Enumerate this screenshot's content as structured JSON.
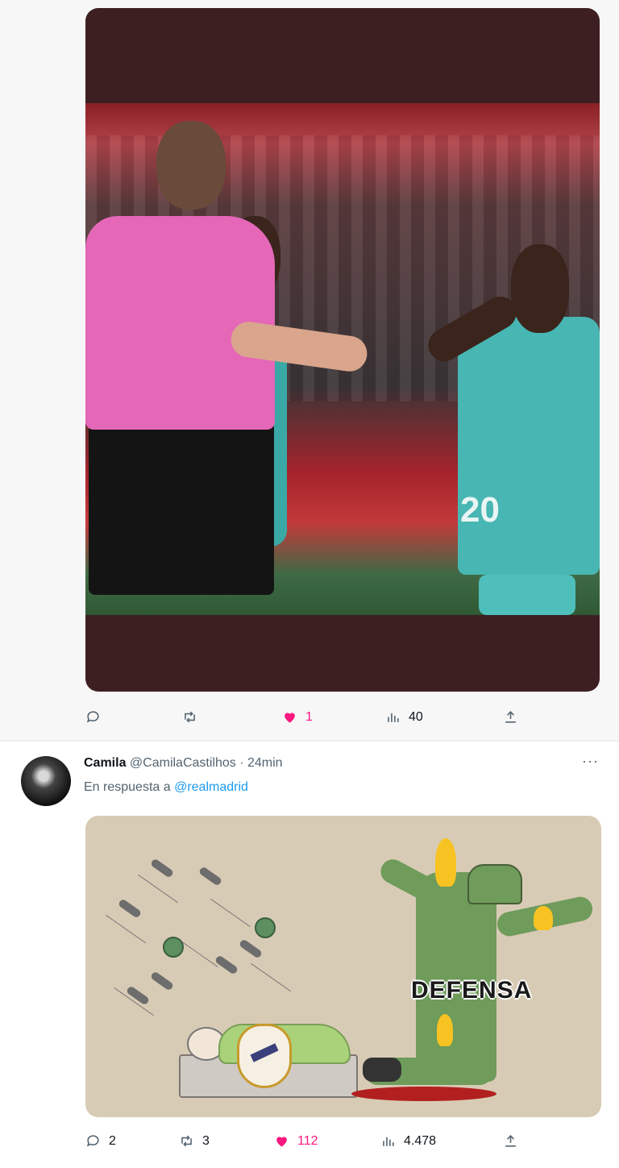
{
  "tweet1": {
    "actions": {
      "replies": "",
      "retweets": "",
      "likes": "1",
      "views": "40"
    },
    "colors": {
      "like": "#f91880",
      "icon": "#536471"
    }
  },
  "tweet2": {
    "author_name": "Camila",
    "handle": "@CamilaCastilhos",
    "separator": "·",
    "time": "24min",
    "reply_prefix": "En respuesta a",
    "reply_mention": "@realmadrid",
    "more": "···",
    "meme_text": "DEFENSA",
    "actions": {
      "replies": "2",
      "retweets": "3",
      "likes": "112",
      "views": "4.478"
    },
    "colors": {
      "mention": "#1d9bf0",
      "like": "#f91880"
    }
  }
}
